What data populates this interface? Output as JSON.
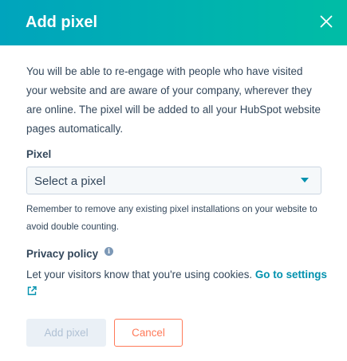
{
  "modal": {
    "title": "Add pixel",
    "close_icon": "close-icon"
  },
  "intro": {
    "text": "You will be able to re-engage with people who have visited your website and are aware of your company, wherever they are online. The pixel will be added to all your HubSpot website pages automatically."
  },
  "pixel_field": {
    "label": "Pixel",
    "value": "Select a pixel",
    "help": "Remember to remove any existing pixel installations on your website to avoid double counting."
  },
  "privacy": {
    "label": "Privacy policy",
    "info_icon": "info-icon",
    "text": "Let your visitors know that you're using cookies.",
    "link_label": "Go to settings",
    "external_icon": "external-link-icon"
  },
  "footer": {
    "primary_label": "Add pixel",
    "secondary_label": "Cancel"
  },
  "colors": {
    "header_gradient_start": "#00a4bd",
    "header_gradient_end": "#00bda5",
    "link": "#0091ae",
    "cancel_accent": "#ff7a59",
    "disabled_bg": "#eaf0f6",
    "text": "#33475b"
  }
}
